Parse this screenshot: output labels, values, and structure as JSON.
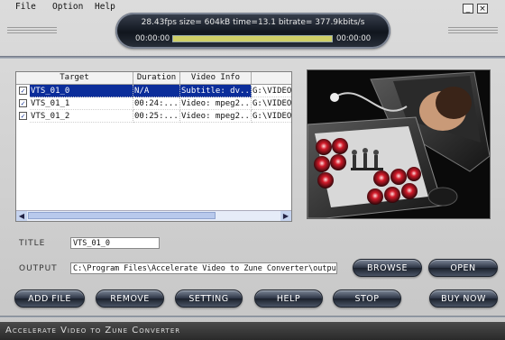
{
  "menu": {
    "items": [
      {
        "label": "File"
      },
      {
        "label": "Option"
      },
      {
        "label": "Help"
      }
    ]
  },
  "window_controls": {
    "minimize": "_",
    "close": "×"
  },
  "status": {
    "info": "28.43fps size=  604kB time=13.1 bitrate= 377.9kbits/s",
    "elapsed": "00:00:00",
    "total": "00:00:00",
    "progress": 1.0
  },
  "table": {
    "columns": [
      "Target",
      "Duration",
      "Video Info",
      ""
    ],
    "rows": [
      {
        "checked": true,
        "target": "VTS_01_0",
        "duration": "N/A",
        "video_info": "Subtitle: dv...",
        "path": "G:\\VIDEO_",
        "selected": true
      },
      {
        "checked": true,
        "target": "VTS_01_1",
        "duration": "00:24:...",
        "video_info": "Video: mpeg2...",
        "path": "G:\\VIDEO_",
        "selected": false
      },
      {
        "checked": true,
        "target": "VTS_01_2",
        "duration": "00:25:...",
        "video_info": "Video: mpeg2...",
        "path": "G:\\VIDEO_",
        "selected": false
      }
    ]
  },
  "form": {
    "title_label": "TITLE",
    "title_value": "VTS_01_0",
    "output_label": "OUTPUT",
    "output_value": "C:\\Program Files\\Accelerate Video to Zune Converter\\output\\"
  },
  "buttons": {
    "browse": "BROWSE",
    "open": "OPEN",
    "add_file": "ADD FILE",
    "remove": "REMOVE",
    "setting": "SETTING",
    "help": "HELP",
    "stop": "STOP",
    "buy_now": "BUY NOW"
  },
  "footer": {
    "app_name": "Accelerate Video to Zune Converter"
  },
  "colors": {
    "selection": "#0b2d9a",
    "button_dark": "#2b3343",
    "capsule": "#10151d"
  }
}
